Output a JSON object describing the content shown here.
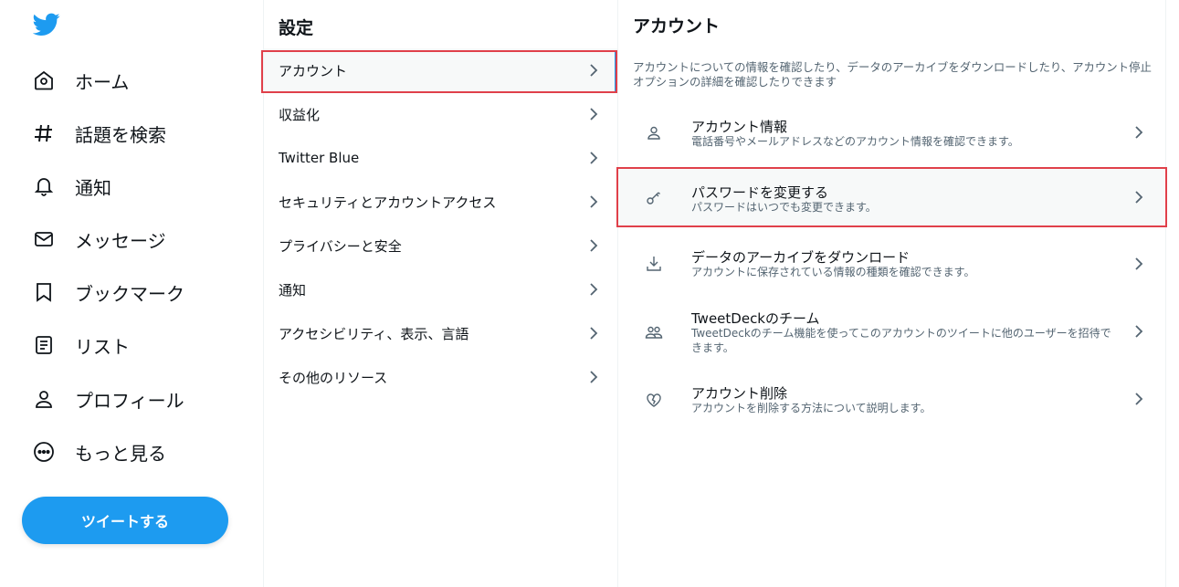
{
  "nav": {
    "items": [
      {
        "label": "ホーム",
        "icon": "home-icon"
      },
      {
        "label": "話題を検索",
        "icon": "hashtag-icon"
      },
      {
        "label": "通知",
        "icon": "bell-icon"
      },
      {
        "label": "メッセージ",
        "icon": "mail-icon"
      },
      {
        "label": "ブックマーク",
        "icon": "bookmark-icon"
      },
      {
        "label": "リスト",
        "icon": "list-icon"
      },
      {
        "label": "プロフィール",
        "icon": "person-icon"
      },
      {
        "label": "もっと見る",
        "icon": "more-icon"
      }
    ],
    "tweet_button": "ツイートする",
    "brand_color": "#1d9bf0"
  },
  "settings": {
    "title": "設定",
    "items": [
      {
        "label": "アカウント"
      },
      {
        "label": "収益化"
      },
      {
        "label": "Twitter Blue"
      },
      {
        "label": "セキュリティとアカウントアクセス"
      },
      {
        "label": "プライバシーと安全"
      },
      {
        "label": "通知"
      },
      {
        "label": "アクセシビリティ、表示、言語"
      },
      {
        "label": "その他のリソース"
      }
    ],
    "selected": "アカウント"
  },
  "account": {
    "title": "アカウント",
    "description": "アカウントについての情報を確認したり、データのアーカイブをダウンロードしたり、アカウント停止オプションの詳細を確認したりできます",
    "items": [
      {
        "title": "アカウント情報",
        "subtitle": "電話番号やメールアドレスなどのアカウント情報を確認できます。",
        "icon": "person-icon"
      },
      {
        "title": "パスワードを変更する",
        "subtitle": "パスワードはいつでも変更できます。",
        "icon": "key-icon"
      },
      {
        "title": "データのアーカイブをダウンロード",
        "subtitle": "アカウントに保存されている情報の種類を確認できます。",
        "icon": "download-icon"
      },
      {
        "title": "TweetDeckのチーム",
        "subtitle": "TweetDeckのチーム機能を使ってこのアカウントのツイートに他のユーザーを招待できます。",
        "icon": "people-icon"
      },
      {
        "title": "アカウント削除",
        "subtitle": "アカウントを削除する方法について説明します。",
        "icon": "broken-heart-icon"
      }
    ],
    "selected": "パスワードを変更する"
  },
  "colors": {
    "highlight": "#e0404a",
    "text": "#0f1419",
    "secondary_text": "#536471"
  }
}
